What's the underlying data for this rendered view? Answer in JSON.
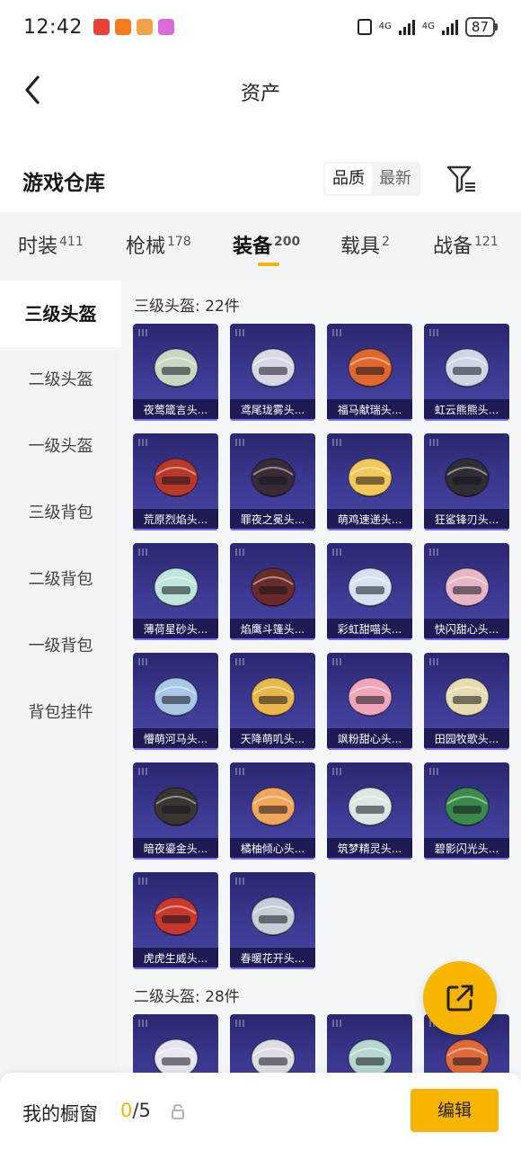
{
  "status_bar": {
    "time": "12:42",
    "network_1": "4G",
    "network_2": "4G",
    "battery": "87",
    "app_icon_colors": [
      "#e8423b",
      "#f57b1f",
      "#f2a24a",
      "#d96bd8"
    ]
  },
  "header": {
    "title": "资产"
  },
  "warehouse": {
    "title": "游戏仓库",
    "sort_options": [
      "品质",
      "最新"
    ],
    "active_sort": "品质"
  },
  "category_tabs": [
    {
      "label": "时装",
      "count": "411"
    },
    {
      "label": "枪械",
      "count": "178"
    },
    {
      "label": "装备",
      "count": "200"
    },
    {
      "label": "载具",
      "count": "2"
    },
    {
      "label": "战备",
      "count": "121"
    }
  ],
  "active_category": "装备",
  "sidebar_items": [
    "三级头盔",
    "二级头盔",
    "一级头盔",
    "三级背包",
    "二级背包",
    "一级背包",
    "背包挂件"
  ],
  "active_sidebar": "三级头盔",
  "sections": [
    {
      "title": "三级头盔: 22件",
      "items": [
        {
          "name": "夜莺箴言头...",
          "icon": "helmet-icon",
          "color": "#c9d8c2"
        },
        {
          "name": "鸢尾珑雾头...",
          "icon": "helmet-icon",
          "color": "#d9d9e6"
        },
        {
          "name": "福马献瑞头...",
          "icon": "helmet-icon",
          "color": "#e0682c"
        },
        {
          "name": "虹云熊熊头...",
          "icon": "helmet-icon",
          "color": "#cfd6e6"
        },
        {
          "name": "荒原烈焰头...",
          "icon": "helmet-icon",
          "color": "#b8382a"
        },
        {
          "name": "罪夜之冕头...",
          "icon": "helmet-icon",
          "color": "#3a2a36"
        },
        {
          "name": "萌鸡速递头...",
          "icon": "helmet-icon",
          "color": "#f2c85a"
        },
        {
          "name": "狂鲨锋刃头...",
          "icon": "helmet-icon",
          "color": "#2e2e34"
        },
        {
          "name": "薄荷星砂头...",
          "icon": "helmet-icon",
          "color": "#bfe6da"
        },
        {
          "name": "焰鹰斗篷头...",
          "icon": "helmet-icon",
          "color": "#6a2a2a"
        },
        {
          "name": "彩虹甜喵头...",
          "icon": "helmet-icon",
          "color": "#d6e2f2"
        },
        {
          "name": "快闪甜心头...",
          "icon": "helmet-icon",
          "color": "#e7b6c4"
        },
        {
          "name": "懵萌河马头...",
          "icon": "helmet-icon",
          "color": "#a9c8e8"
        },
        {
          "name": "天降萌叽头...",
          "icon": "helmet-icon",
          "color": "#e8b84a"
        },
        {
          "name": "飒粉甜心头...",
          "icon": "helmet-icon",
          "color": "#f0a6b8"
        },
        {
          "name": "田园牧歌头...",
          "icon": "helmet-icon",
          "color": "#e6dcb0"
        },
        {
          "name": "暗夜鎏金头...",
          "icon": "helmet-icon",
          "color": "#3a3530"
        },
        {
          "name": "橘柚倾心头...",
          "icon": "helmet-icon",
          "color": "#f2a65a"
        },
        {
          "name": "筑梦精灵头...",
          "icon": "helmet-icon",
          "color": "#dce6e2"
        },
        {
          "name": "碧影闪光头...",
          "icon": "helmet-icon",
          "color": "#3c8a4a"
        },
        {
          "name": "虎虎生威头...",
          "icon": "helmet-icon",
          "color": "#c8382c"
        },
        {
          "name": "春暖花开头...",
          "icon": "helmet-icon",
          "color": "#c6cfd6"
        }
      ]
    },
    {
      "title": "二级头盔: 28件",
      "items": [
        {
          "name": "",
          "icon": "helmet-icon",
          "color": "#e6e6f0"
        },
        {
          "name": "",
          "icon": "helmet-icon",
          "color": "#dcdce4"
        },
        {
          "name": "",
          "icon": "helmet-icon",
          "color": "#b6d6d0"
        },
        {
          "name": "",
          "icon": "helmet-icon",
          "color": "#e06a3a"
        }
      ]
    }
  ],
  "bottom_bar": {
    "label": "我的橱窗",
    "used": "0",
    "separator": "/",
    "total": "5",
    "edit_label": "编辑"
  },
  "colors": {
    "accent": "#f7b500",
    "card_bg": "#3d3a94",
    "sidebar_bg": "#f3f4f6"
  }
}
